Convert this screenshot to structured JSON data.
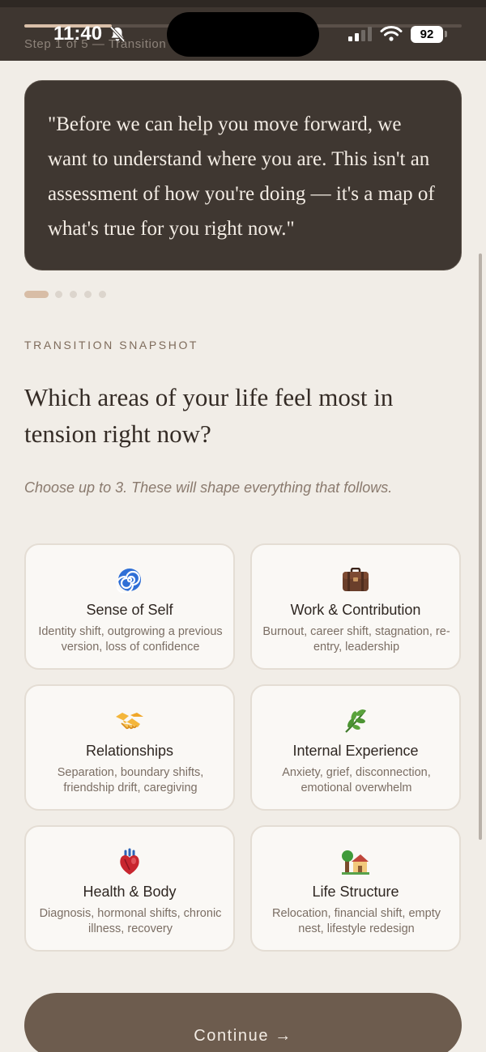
{
  "status_bar": {
    "time": "11:40",
    "battery": "92"
  },
  "header": {
    "step_label": "Step 1 of 5 — Transition",
    "progress": 0.2
  },
  "quote": {
    "text": "\"Before we can help you move forward, we want to understand where you are. This isn't an assessment of how you're doing — it's a map of what's true for you right now.\""
  },
  "carousel": {
    "count": 5,
    "active": 0
  },
  "section": {
    "eyebrow": "TRANSITION SNAPSHOT",
    "question": "Which areas of your life feel most in tension right now?",
    "subtitle": "Choose up to 3. These will shape everything that follows."
  },
  "options": [
    {
      "icon": "spiral-icon",
      "title": "Sense of Self",
      "desc": "Identity shift, outgrowing a previous version, loss of confidence"
    },
    {
      "icon": "briefcase-icon",
      "title": "Work & Contribution",
      "desc": "Burnout, career shift, stagnation, re-entry, leadership"
    },
    {
      "icon": "handshake-icon",
      "title": "Relationships",
      "desc": "Separation, boundary shifts, friendship drift, caregiving"
    },
    {
      "icon": "herb-icon",
      "title": "Internal Experience",
      "desc": "Anxiety, grief, disconnection, emotional overwhelm"
    },
    {
      "icon": "anatomical-heart-icon",
      "title": "Health & Body",
      "desc": "Diagnosis, hormonal shifts, chronic illness, recovery"
    },
    {
      "icon": "house-with-garden-icon",
      "title": "Life Structure",
      "desc": "Relocation, financial shift, empty nest, lifestyle redesign"
    }
  ],
  "actions": {
    "continue_label": "Continue →"
  },
  "colors": {
    "background": "#f1ede7",
    "dark_panel": "#3f3731",
    "accent": "#d8bda6",
    "button": "#6d5c4e"
  }
}
